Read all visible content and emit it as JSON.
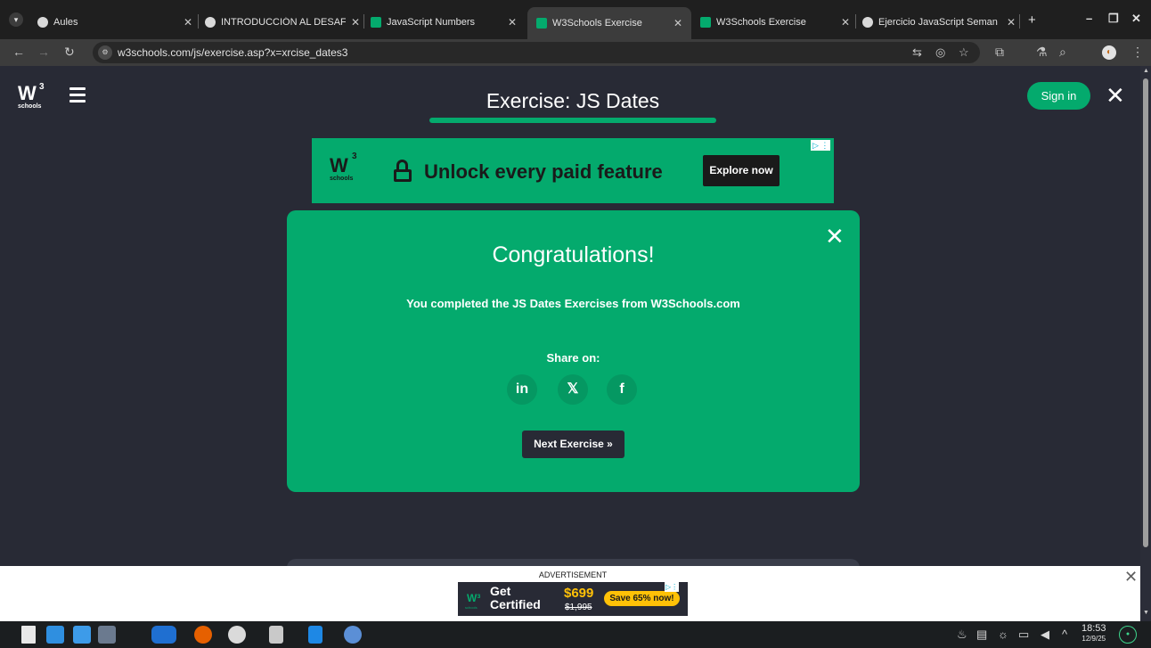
{
  "browser": {
    "tabs": [
      {
        "label": "Aules",
        "favicon": "aules-icon",
        "color": "#D9D9D9"
      },
      {
        "label": "INTRODUCCIÓN AL DESAF",
        "favicon": "globe-icon",
        "color": "#D9D9D9"
      },
      {
        "label": "JavaScript Numbers",
        "favicon": "w3schools-icon",
        "color": "#04AA6D"
      },
      {
        "label": "W3Schools Exercise",
        "favicon": "w3schools-icon",
        "color": "#04AA6D",
        "active": true
      },
      {
        "label": "W3Schools Exercise",
        "favicon": "w3schools-icon",
        "color": "#04AA6D"
      },
      {
        "label": "Ejercicio JavaScript Seman",
        "favicon": "globe-icon",
        "color": "#D9D9D9"
      }
    ],
    "url": "w3schools.com/js/exercise.asp?x=xrcise_dates3"
  },
  "page": {
    "title": "Exercise: JS Dates",
    "signin_label": "Sign in"
  },
  "top_ad": {
    "logo_w": "W",
    "logo_sup": "3",
    "logo_schools": "schools",
    "headline": "Unlock every paid feature",
    "button": "Explore now"
  },
  "modal": {
    "title": "Congratulations!",
    "message": "You completed the JS Dates Exercises from W3Schools.com",
    "share_label": "Share on:",
    "share": [
      {
        "label": "in",
        "icon": "linkedin-icon"
      },
      {
        "label": "𝕏",
        "icon": "x-twitter-icon"
      },
      {
        "label": "f",
        "icon": "facebook-icon"
      }
    ],
    "next_label": "Next Exercise »"
  },
  "bottom_ad": {
    "label": "ADVERTISEMENT",
    "get_line1": "Get",
    "get_line2": "Certified",
    "price": "$699",
    "old_price": "$1,995",
    "save": "Save 65% now!"
  },
  "taskbar": {
    "time": "18:53",
    "date": "12/9/25"
  },
  "colors": {
    "brand_green": "#04AA6D",
    "page_bg": "#282A35",
    "price_yellow": "#FFC107"
  }
}
